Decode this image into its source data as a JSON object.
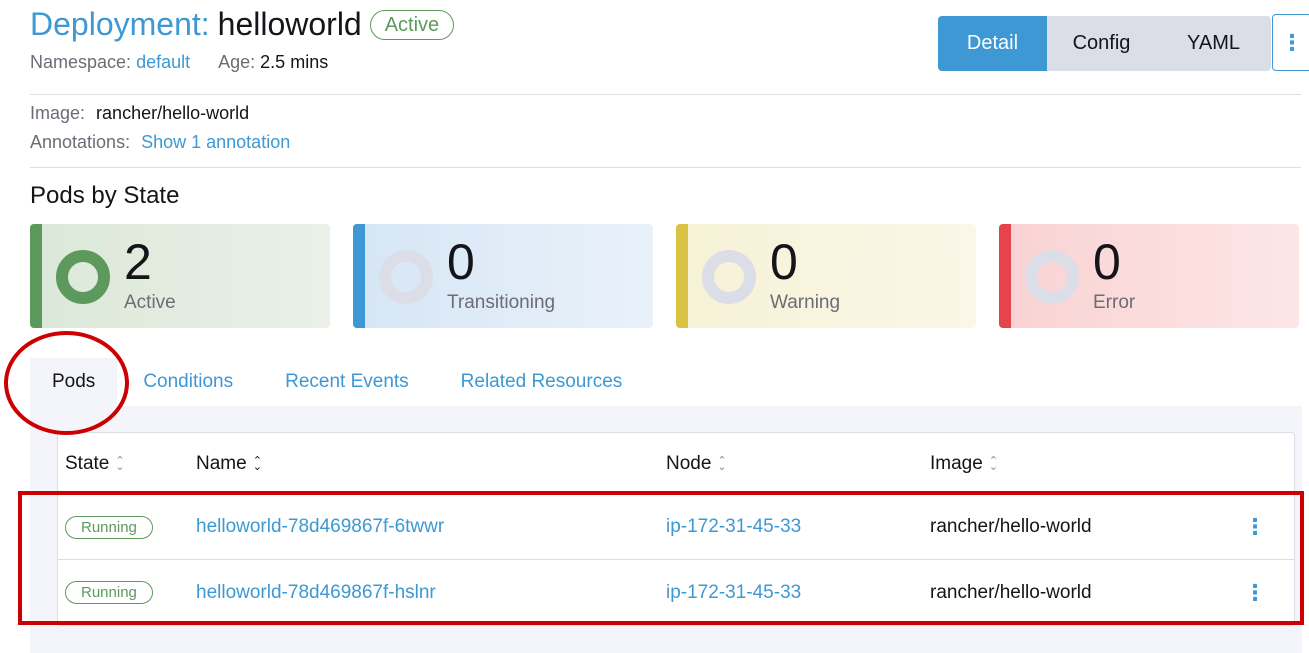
{
  "header": {
    "resource_type": "Deployment:",
    "resource_name": "helloworld",
    "status": "Active",
    "namespace_label": "Namespace:",
    "namespace_value": "default",
    "age_label": "Age:",
    "age_value": "2.5 mins"
  },
  "view_toggle": {
    "detail": "Detail",
    "config": "Config",
    "yaml": "YAML",
    "more": "⋮"
  },
  "info": {
    "image_label": "Image:",
    "image_value": "rancher/hello-world",
    "annotations_label": "Annotations:",
    "annotations_link": "Show 1 annotation"
  },
  "pods_by_state": {
    "title": "Pods by State",
    "cards": [
      {
        "count": "2",
        "label": "Active",
        "color": "#5d995d",
        "bg_from": "#dbe8d8",
        "bg_to": "#eaf0e8"
      },
      {
        "count": "0",
        "label": "Transitioning",
        "color": "#3d98d3",
        "bg_from": "#d6e6f5",
        "bg_to": "#e9f1fa"
      },
      {
        "count": "0",
        "label": "Warning",
        "color": "#dac342",
        "bg_from": "#f6f1d6",
        "bg_to": "#faf7e8"
      },
      {
        "count": "0",
        "label": "Error",
        "color": "#e5444d",
        "bg_from": "#f9d2d3",
        "bg_to": "#fde6e6"
      }
    ]
  },
  "tabs": [
    "Pods",
    "Conditions",
    "Recent Events",
    "Related Resources"
  ],
  "table": {
    "headers": [
      "State",
      "Name",
      "Node",
      "Image"
    ],
    "rows": [
      {
        "state": "Running",
        "name": "helloworld-78d469867f-6twwr",
        "node": "ip-172-31-45-33",
        "image": "rancher/hello-world"
      },
      {
        "state": "Running",
        "name": "helloworld-78d469867f-hslnr",
        "node": "ip-172-31-45-33",
        "image": "rancher/hello-world"
      }
    ]
  },
  "colors": {
    "accent": "#3d98d3",
    "success": "#5d995d",
    "annotation": "#cc0000"
  }
}
